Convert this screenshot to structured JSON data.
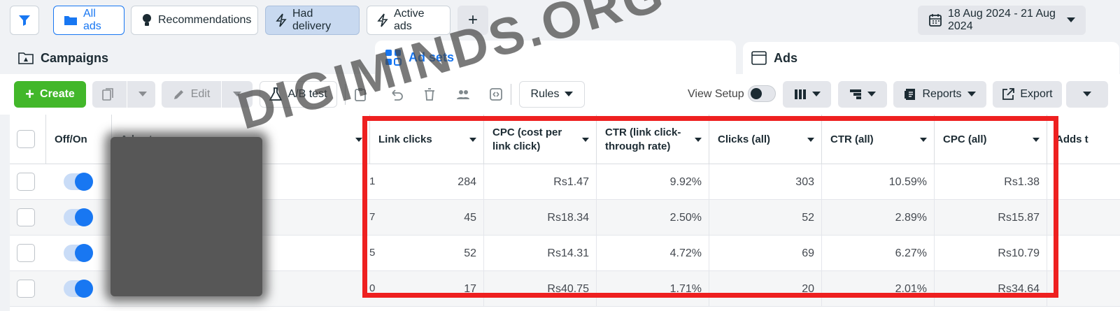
{
  "topbar": {
    "filters": [
      {
        "label": "All ads",
        "icon": "folder-icon"
      },
      {
        "label": "Recommendations",
        "icon": "lightbulb-icon"
      },
      {
        "label": "Had delivery",
        "icon": "lightning-icon"
      },
      {
        "label": "Active ads",
        "icon": "lightning-icon"
      }
    ],
    "add_label": "+",
    "date_range": "18 Aug 2024 - 21 Aug 2024"
  },
  "tabs": [
    {
      "label": "Campaigns",
      "icon": "campaign-folder-icon"
    },
    {
      "label": "Ad sets",
      "icon": "grid-icon"
    },
    {
      "label": "Ads",
      "icon": "ad-window-icon"
    }
  ],
  "toolbar": {
    "create_label": "Create",
    "edit_label": "Edit",
    "ab_test_label": "A/B test",
    "rules_label": "Rules",
    "view_setup_label": "View Setup",
    "reports_label": "Reports",
    "export_label": "Export"
  },
  "table": {
    "columns": [
      "Off/On",
      "Ad set",
      "Link clicks",
      "CPC (cost per link click)",
      "CTR (link click-through rate)",
      "Clicks (all)",
      "CTR (all)",
      "CPC (all)",
      "Adds t"
    ],
    "rows": [
      {
        "results_digit": "1",
        "link_clicks": "284",
        "cpc_link": "Rs1.47",
        "ctr_link": "9.92%",
        "clicks_all": "303",
        "ctr_all": "10.59%",
        "cpc_all": "Rs1.38"
      },
      {
        "results_digit": "7",
        "link_clicks": "45",
        "cpc_link": "Rs18.34",
        "ctr_link": "2.50%",
        "clicks_all": "52",
        "ctr_all": "2.89%",
        "cpc_all": "Rs15.87"
      },
      {
        "results_digit": "5",
        "link_clicks": "52",
        "cpc_link": "Rs14.31",
        "ctr_link": "4.72%",
        "clicks_all": "69",
        "ctr_all": "6.27%",
        "cpc_all": "Rs10.79"
      },
      {
        "results_digit": "0",
        "link_clicks": "17",
        "cpc_link": "Rs40.75",
        "ctr_link": "1.71%",
        "clicks_all": "20",
        "ctr_all": "2.01%",
        "cpc_all": "Rs34.64"
      }
    ]
  },
  "watermark": "DIGIMINDS.ORG",
  "colors": {
    "accent": "#1877f2",
    "create_green": "#42b72a",
    "highlight_red": "#ee2020"
  }
}
